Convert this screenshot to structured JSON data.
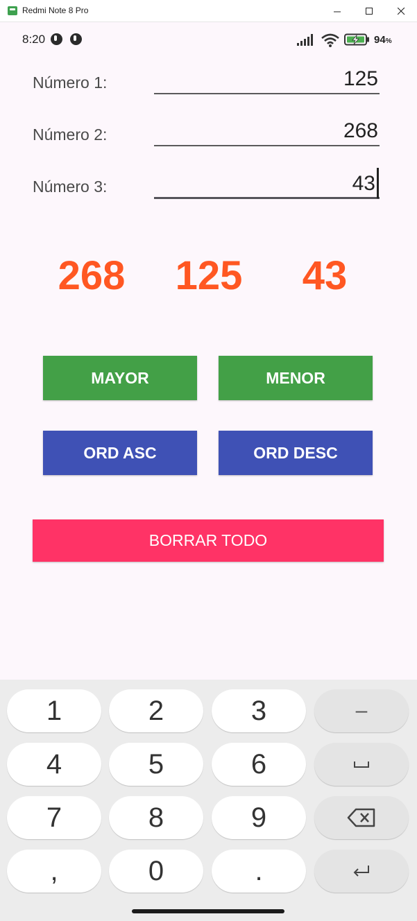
{
  "window": {
    "title": "Redmi Note 8 Pro"
  },
  "status_bar": {
    "time": "8:20",
    "battery_percent": "94",
    "battery_unit": "%"
  },
  "form": {
    "rows": [
      {
        "label": "Número 1:",
        "value": "125"
      },
      {
        "label": "Número 2:",
        "value": "268"
      },
      {
        "label": "Número 3:",
        "value": "43"
      }
    ]
  },
  "results": [
    "268",
    "125",
    "43"
  ],
  "buttons": {
    "mayor": "MAYOR",
    "menor": "MENOR",
    "ord_asc": "ORD ASC",
    "ord_desc": "ORD DESC",
    "borrar": "BORRAR TODO"
  },
  "keyboard": {
    "keys": [
      "1",
      "2",
      "3",
      "4",
      "5",
      "6",
      "7",
      "8",
      "9",
      ",",
      "0",
      "."
    ],
    "minus": "–"
  },
  "colors": {
    "result": "#ff5722",
    "green_button": "#43a047",
    "blue_button": "#3f51b5",
    "red_button": "#ff3366",
    "background": "#fdf7fc"
  }
}
